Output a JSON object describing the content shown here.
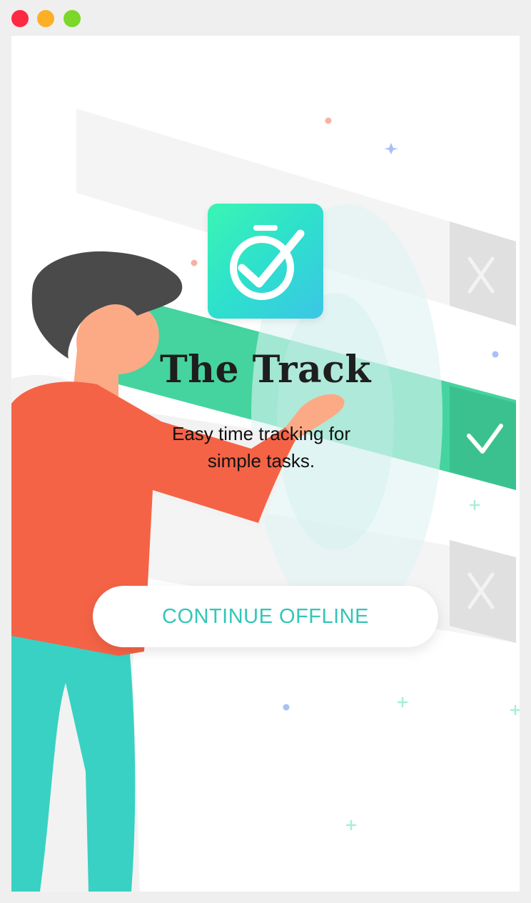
{
  "window": {
    "controls": [
      "close",
      "minimize",
      "maximize"
    ]
  },
  "app": {
    "title": "The Track",
    "subtitle": "Easy time tracking for simple tasks.",
    "cta_label": "CONTINUE OFFLINE",
    "icon": "stopwatch-check-icon"
  },
  "colors": {
    "accent": "#33c6b7",
    "green_bar": "#3dd59f",
    "shirt": "#f56346",
    "pants": "#39d1c3",
    "hair": "#4a4a4a",
    "skin": "#fcaa85",
    "close_dot": "#fe2942",
    "minimize_dot": "#fdaf26",
    "maximize_dot": "#7cd728"
  }
}
